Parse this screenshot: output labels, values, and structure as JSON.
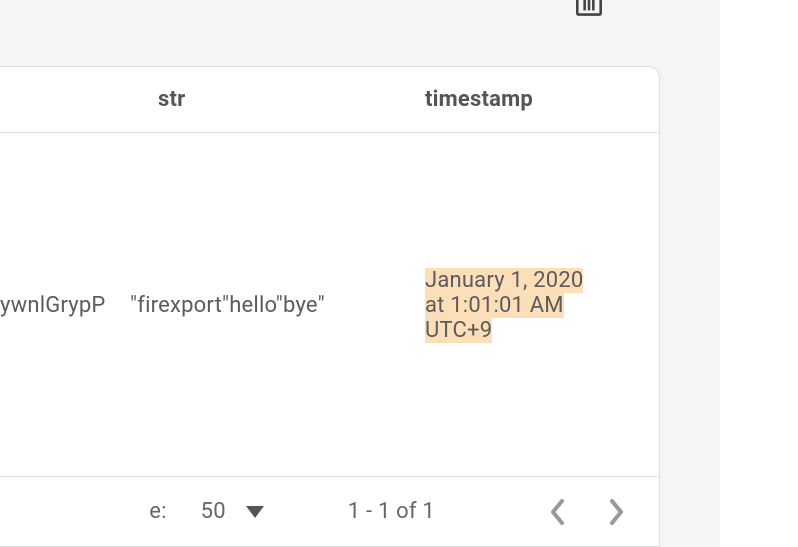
{
  "toolbar": {
    "chart_icon": "bar-chart"
  },
  "table": {
    "columns": {
      "id_header": "",
      "str_header": "str",
      "timestamp_header": "timestamp"
    },
    "rows": [
      {
        "id": "ywnlGrypP",
        "str": "\"firexport\"hello\"bye\"",
        "timestamp_line1": "January 1, 2020",
        "timestamp_line2": "at 1:01:01 AM",
        "timestamp_line3": "UTC+9"
      }
    ]
  },
  "pager": {
    "rows_label": "e:",
    "page_size": "50",
    "range": "1 - 1 of 1"
  }
}
